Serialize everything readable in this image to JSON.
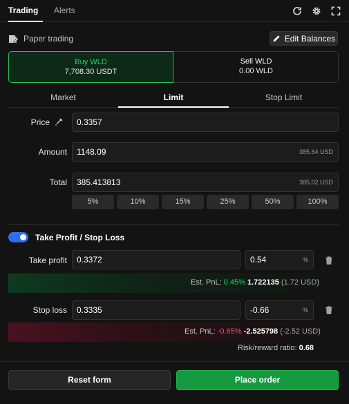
{
  "header": {
    "tabs": [
      {
        "label": "Trading",
        "active": true
      },
      {
        "label": "Alerts",
        "active": false
      }
    ],
    "icons": [
      "refresh-icon",
      "gear-icon",
      "fullscreen-icon"
    ]
  },
  "paper": {
    "label": "Paper trading",
    "edit_label": "Edit Balances"
  },
  "side": {
    "buy_title": "Buy WLD",
    "buy_sub": "7,708.30 USDT",
    "sell_title": "Sell WLD",
    "sell_sub": "0.00 WLD"
  },
  "order_tabs": [
    {
      "label": "Market",
      "active": false
    },
    {
      "label": "Limit",
      "active": true
    },
    {
      "label": "Stop Limit",
      "active": false
    }
  ],
  "form": {
    "price_label": "Price",
    "price_value": "0.3357",
    "amount_label": "Amount",
    "amount_value": "1148.09",
    "amount_suffix": "385.64 USD",
    "total_label": "Total",
    "total_value": "385.413813",
    "total_suffix": "385.02 USD",
    "percents": [
      "5%",
      "10%",
      "15%",
      "25%",
      "50%",
      "100%"
    ]
  },
  "tpsl": {
    "label": "Take Profit / Stop Loss",
    "enabled": true,
    "tp_label": "Take profit",
    "tp_price": "0.3372",
    "tp_pct": "0.54",
    "tp_pnl_prefix": "Est. PnL:",
    "tp_pnl_pct": "0.45%",
    "tp_pnl_value": "1.722135",
    "tp_pnl_usd": "(1.72 USD)",
    "sl_label": "Stop loss",
    "sl_price": "0.3335",
    "sl_pct": "-0.66",
    "sl_pnl_prefix": "Est. PnL:",
    "sl_pnl_pct": "-0.65%",
    "sl_pnl_value": "-2.525798",
    "sl_pnl_usd": "(-2.52 USD)",
    "pct_suffix": "%",
    "rr_label": "Risk/reward ratio:",
    "rr_value": "0.68"
  },
  "buttons": {
    "reset_label": "Reset form",
    "place_label": "Place order"
  },
  "colors": {
    "accent_green": "#1fd65e",
    "accent_red": "#f0506e",
    "toggle_blue": "#2d6df0",
    "place_order": "#169a3f"
  }
}
